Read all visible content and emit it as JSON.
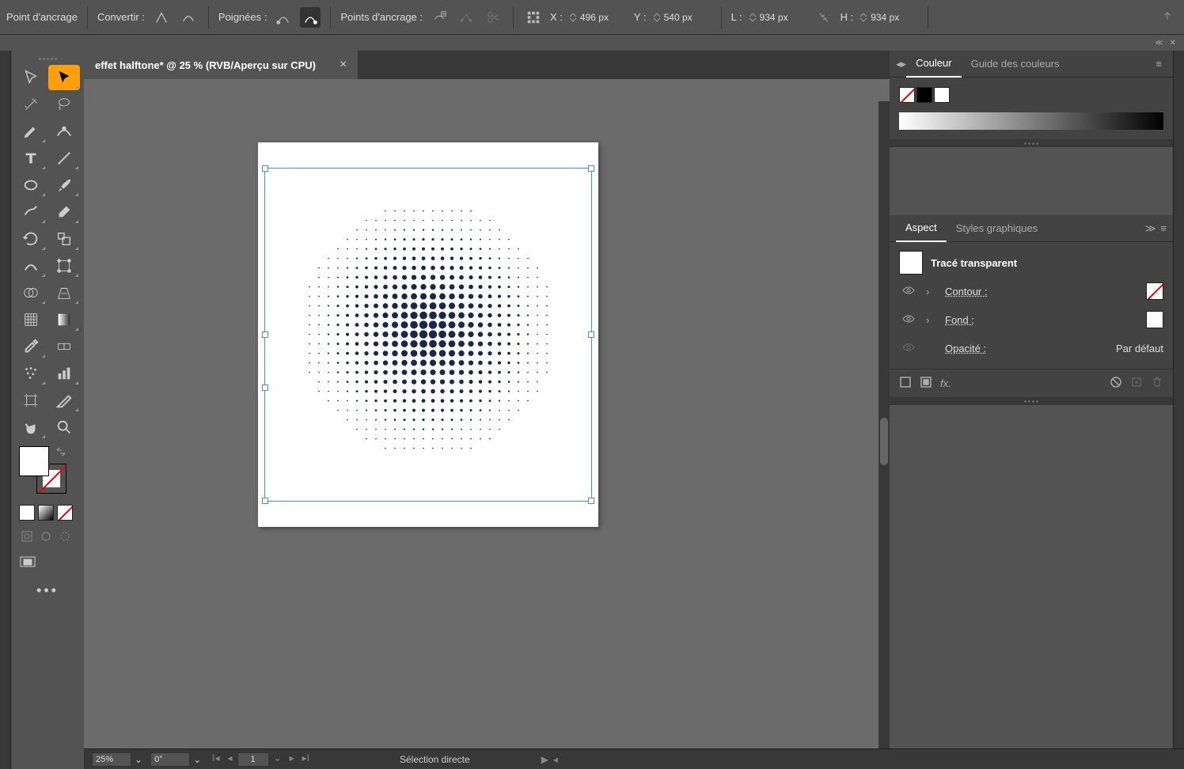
{
  "topbar": {
    "anchor_point": "Point d'ancrage",
    "convert": "Convertir :",
    "handles": "Poignées :",
    "anchor_points": "Points d'ancrage :",
    "x_label": "X :",
    "x_value": "496 px",
    "y_label": "Y :",
    "y_value": "540 px",
    "l_label": "L :",
    "l_value": "934 px",
    "h_label": "H :",
    "h_value": "934 px"
  },
  "tab": {
    "title": "effet halftone* @ 25 % (RVB/Aperçu sur CPU)"
  },
  "panels": {
    "color": {
      "tab1": "Couleur",
      "tab2": "Guide des couleurs"
    },
    "aspect": {
      "tab1": "Aspect",
      "tab2": "Styles graphiques",
      "title": "Tracé transparent",
      "contour": "Contour :",
      "fond": "Fond :",
      "opacity": "Opacité :",
      "opacity_val": "Par défaut"
    }
  },
  "status": {
    "zoom": "25%",
    "angle": "0°",
    "page": "1",
    "tool": "Sélection directe"
  }
}
